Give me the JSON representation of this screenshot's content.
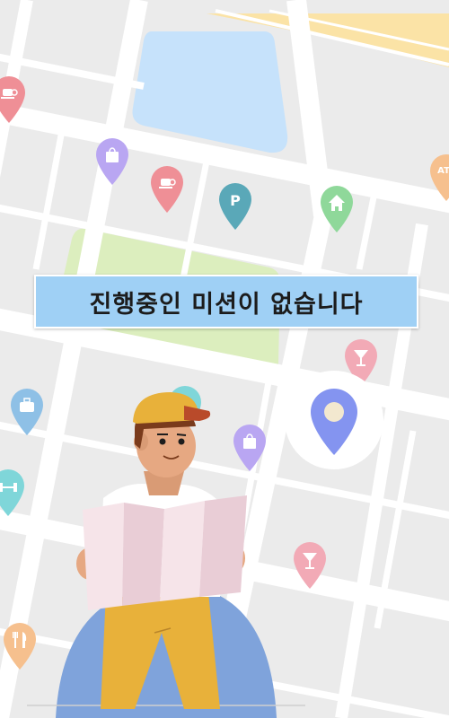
{
  "banner": {
    "message": "진행중인 미션이 없습니다"
  },
  "map": {
    "background_color": "#ebebeb",
    "road_color": "#ffffff",
    "water_color": "#c6e2fb",
    "park_color": "#dceebe",
    "highway_color": "#fbe3a6"
  },
  "markers": [
    {
      "id": "cafe-1",
      "icon": "coffee-cup-icon",
      "color": "#ef8f96"
    },
    {
      "id": "shop-1",
      "icon": "shopping-bag-icon",
      "color": "#b9a6f2"
    },
    {
      "id": "cafe-2",
      "icon": "coffee-cup-icon",
      "color": "#ef8f96"
    },
    {
      "id": "parking",
      "icon": "parking-icon",
      "label": "P",
      "color": "#5aa8b8"
    },
    {
      "id": "home",
      "icon": "home-icon",
      "color": "#8fd89a"
    },
    {
      "id": "atm",
      "icon": "atm-icon",
      "label": "AT",
      "color": "#f6c08e"
    },
    {
      "id": "bar-1",
      "icon": "cocktail-glass-icon",
      "color": "#f2aab6"
    },
    {
      "id": "work",
      "icon": "briefcase-icon",
      "color": "#8ec0e6"
    },
    {
      "id": "shop-2",
      "icon": "shopping-bag-icon",
      "color": "#b9a6f2"
    },
    {
      "id": "gym",
      "icon": "dumbbell-icon",
      "color": "#7fd6d9"
    },
    {
      "id": "bar-2",
      "icon": "cocktail-glass-icon",
      "color": "#f2aab6"
    },
    {
      "id": "restaurant",
      "icon": "fork-knife-icon",
      "color": "#f6c08e"
    }
  ],
  "current_location": {
    "icon": "location-pin-icon",
    "color": "#8494f0"
  },
  "character": {
    "hat_color": "#e8b13a",
    "shirt_color": "#ffffff",
    "pants_color": "#e8b13a",
    "map_color": "#f6e4e9"
  }
}
